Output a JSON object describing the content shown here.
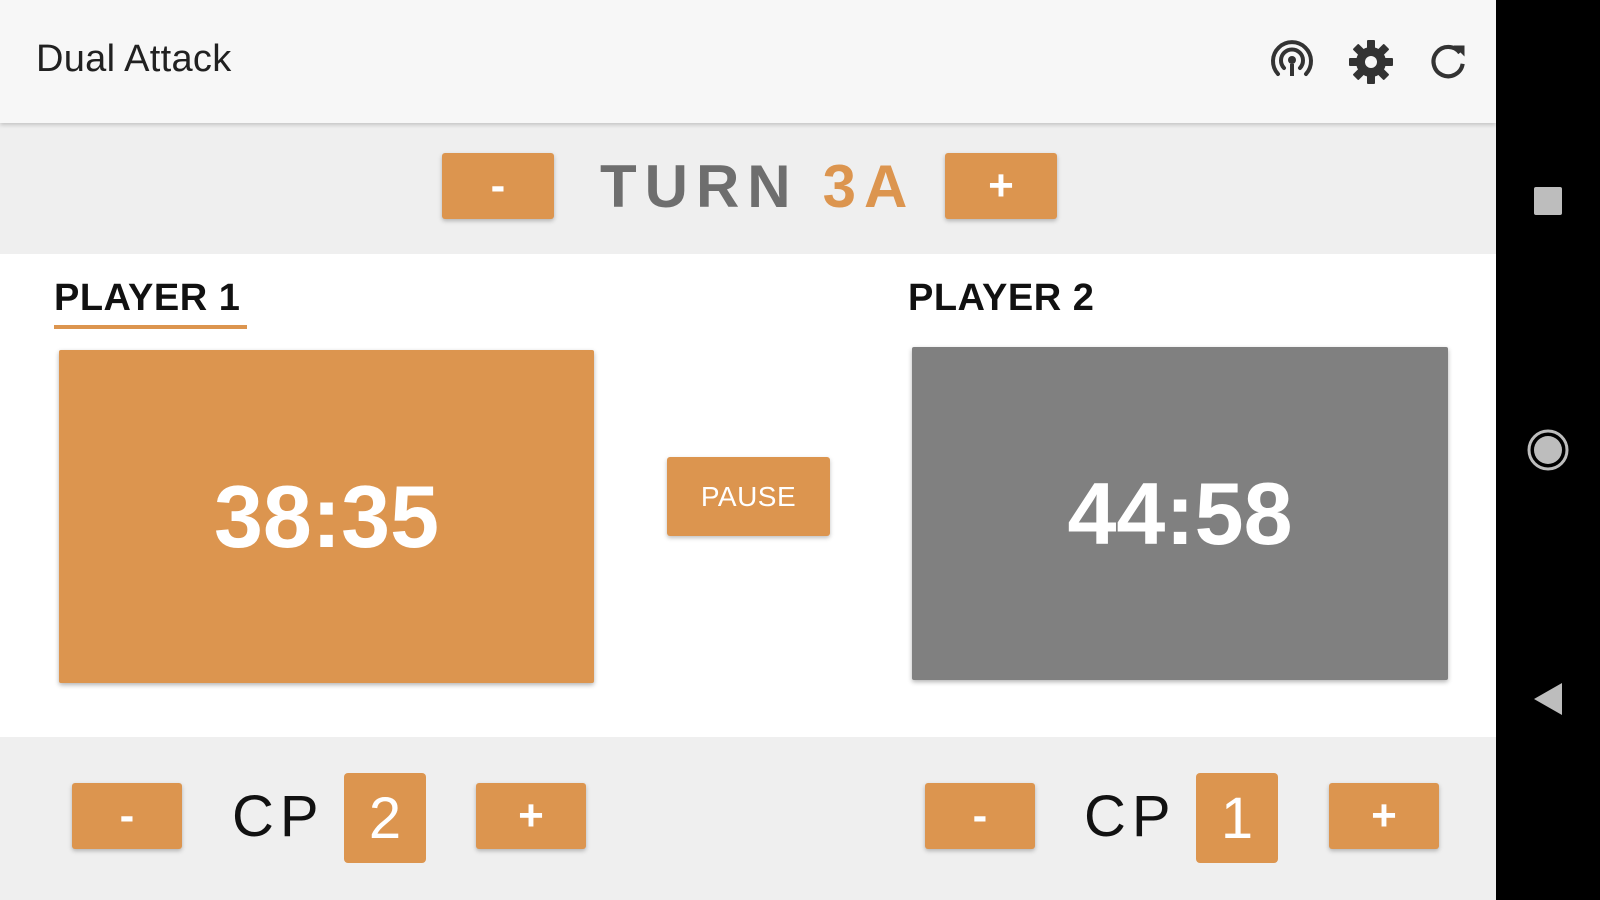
{
  "app": {
    "title": "Dual Attack",
    "accent_color": "#dc954f",
    "inactive_clock_color": "#808080"
  },
  "toolbar": {
    "icons": [
      "broadcast-icon",
      "settings-icon",
      "refresh-icon"
    ]
  },
  "turn": {
    "minus_label": "-",
    "plus_label": "+",
    "word": "TURN",
    "value": "3A"
  },
  "players": [
    {
      "label": "PLAYER 1",
      "time": "38:35",
      "active": true,
      "cp_label": "CP",
      "cp_value": "2",
      "minus_label": "-",
      "plus_label": "+"
    },
    {
      "label": "PLAYER 2",
      "time": "44:58",
      "active": false,
      "cp_label": "CP",
      "cp_value": "1",
      "minus_label": "-",
      "plus_label": "+"
    }
  ],
  "controls": {
    "pause_label": "PAUSE"
  },
  "navbar": {
    "icons": [
      "recents-icon",
      "home-icon",
      "back-icon"
    ]
  }
}
